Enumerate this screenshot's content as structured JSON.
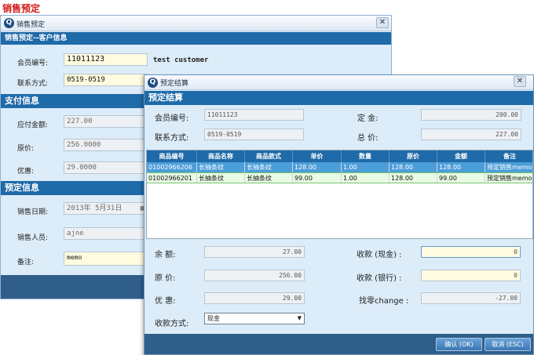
{
  "page_title": "销售预定",
  "win1": {
    "title": "销售预定",
    "close_glyph": "✕",
    "section_customer": "销售预定--客户信息",
    "member_label": "会员编号:",
    "member_value": "11011123",
    "customer_name": "test customer",
    "contact_label": "联系方式:",
    "contact_value": "0519-0519",
    "section_payment": "支付信息",
    "payable_label": "应付金额:",
    "payable_value": "227.00",
    "original_label": "原价:",
    "original_value": "256.0000",
    "discount_label": "优惠:",
    "discount_value": "29.0000",
    "section_booking": "预定信息",
    "date_label": "销售日期:",
    "date_value": "2013年 5月31日",
    "sales_label": "销售人员:",
    "sales_value": "ajne",
    "note_label": "备注:",
    "note_value": "memo"
  },
  "win2": {
    "title": "预定结算",
    "close_glyph": "✕",
    "section_title": "预定结算",
    "member_label": "会员编号:",
    "member_value": "11011123",
    "contact_label": "联系方式:",
    "contact_value": "0519-0519",
    "deposit_label": "定 金:",
    "deposit_value": "200.00",
    "total_label": "总 价:",
    "total_value": "227.00",
    "table": {
      "headers": [
        "商品编号",
        "商品名称",
        "商品款式",
        "单价",
        "数量",
        "原价",
        "金额",
        "备注"
      ],
      "rows": [
        [
          "01002966206",
          "长抽条纹",
          "长抽条纹",
          "128.00",
          "1.00",
          "128.00",
          "128.00",
          "预定销售memo"
        ],
        [
          "01002966201",
          "长抽条纹",
          "长抽条纹",
          "99.00",
          "1.00",
          "128.00",
          "99.00",
          "预定销售memo"
        ]
      ]
    },
    "balance_label": "余 额:",
    "balance_value": "27.00",
    "original_label": "原 价:",
    "original_value": "256.00",
    "discount_label": "优 惠:",
    "discount_value": "29.00",
    "pay_method_label": "收款方式:",
    "pay_method_value": "现金",
    "cash_label": "收款 (现金) :",
    "cash_value": "0",
    "bank_label": "收款 (银行) :",
    "bank_value": "0",
    "change_label": "找零change :",
    "change_value": "-27.00",
    "confirm_label": "确认 (OK)",
    "cancel_label": "取消 (ESC)"
  }
}
